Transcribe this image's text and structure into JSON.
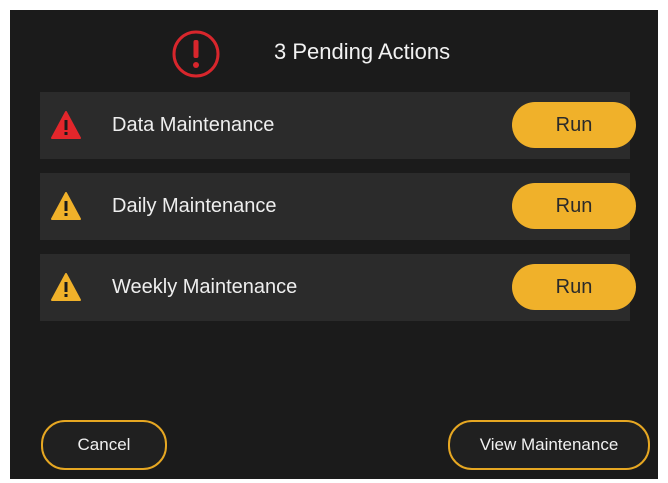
{
  "header": {
    "title": "3 Pending Actions",
    "icon": "alert-circle-icon",
    "icon_color": "#d8262c"
  },
  "actions": [
    {
      "label": "Data Maintenance",
      "severity": "critical",
      "icon": "warning-triangle-icon",
      "icon_color": "#e3262b",
      "button_label": "Run"
    },
    {
      "label": "Daily Maintenance",
      "severity": "warning",
      "icon": "warning-triangle-icon",
      "icon_color": "#f0b12a",
      "button_label": "Run"
    },
    {
      "label": "Weekly Maintenance",
      "severity": "warning",
      "icon": "warning-triangle-icon",
      "icon_color": "#f0b12a",
      "button_label": "Run"
    }
  ],
  "footer": {
    "cancel_label": "Cancel",
    "view_label": "View Maintenance"
  },
  "colors": {
    "background": "#1b1b1b",
    "row_background": "#2b2b2b",
    "accent": "#f0b12a",
    "critical": "#e3262b"
  }
}
